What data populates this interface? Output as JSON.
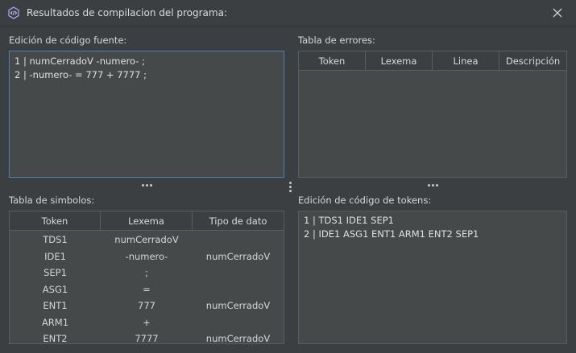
{
  "window": {
    "title": "Resultados de compilacion del programa:",
    "app_icon": "code-brackets-icon",
    "close_icon": "close-icon"
  },
  "source_editor": {
    "label": "Edición de código fuente:",
    "lines": [
      "1 | numCerradoV -numero- ;",
      "2 | -numero- = 777 + 7777 ;"
    ]
  },
  "error_table": {
    "label": "Tabla de errores:",
    "columns": [
      "Token",
      "Lexema",
      "Linea",
      "Descripción"
    ],
    "rows": []
  },
  "symbol_table": {
    "label": "Tabla de simbolos:",
    "columns": [
      "Token",
      "Lexema",
      "Tipo de dato"
    ],
    "rows": [
      [
        "TDS1",
        "numCerradoV",
        ""
      ],
      [
        "IDE1",
        "-numero-",
        "numCerradoV"
      ],
      [
        "SEP1",
        ";",
        ""
      ],
      [
        "ASG1",
        "=",
        ""
      ],
      [
        "ENT1",
        "777",
        "numCerradoV"
      ],
      [
        "ARM1",
        "+",
        ""
      ],
      [
        "ENT2",
        "7777",
        "numCerradoV"
      ]
    ]
  },
  "token_editor": {
    "label": "Edición de código de tokens:",
    "lines": [
      "1 | TDS1 IDE1 SEP1",
      "2 | IDE1 ASG1 ENT1 ARM1 ENT2 SEP1"
    ]
  },
  "colors": {
    "background": "#3c3f41",
    "panel": "#45494a",
    "focus_border": "#4f7fb3"
  }
}
